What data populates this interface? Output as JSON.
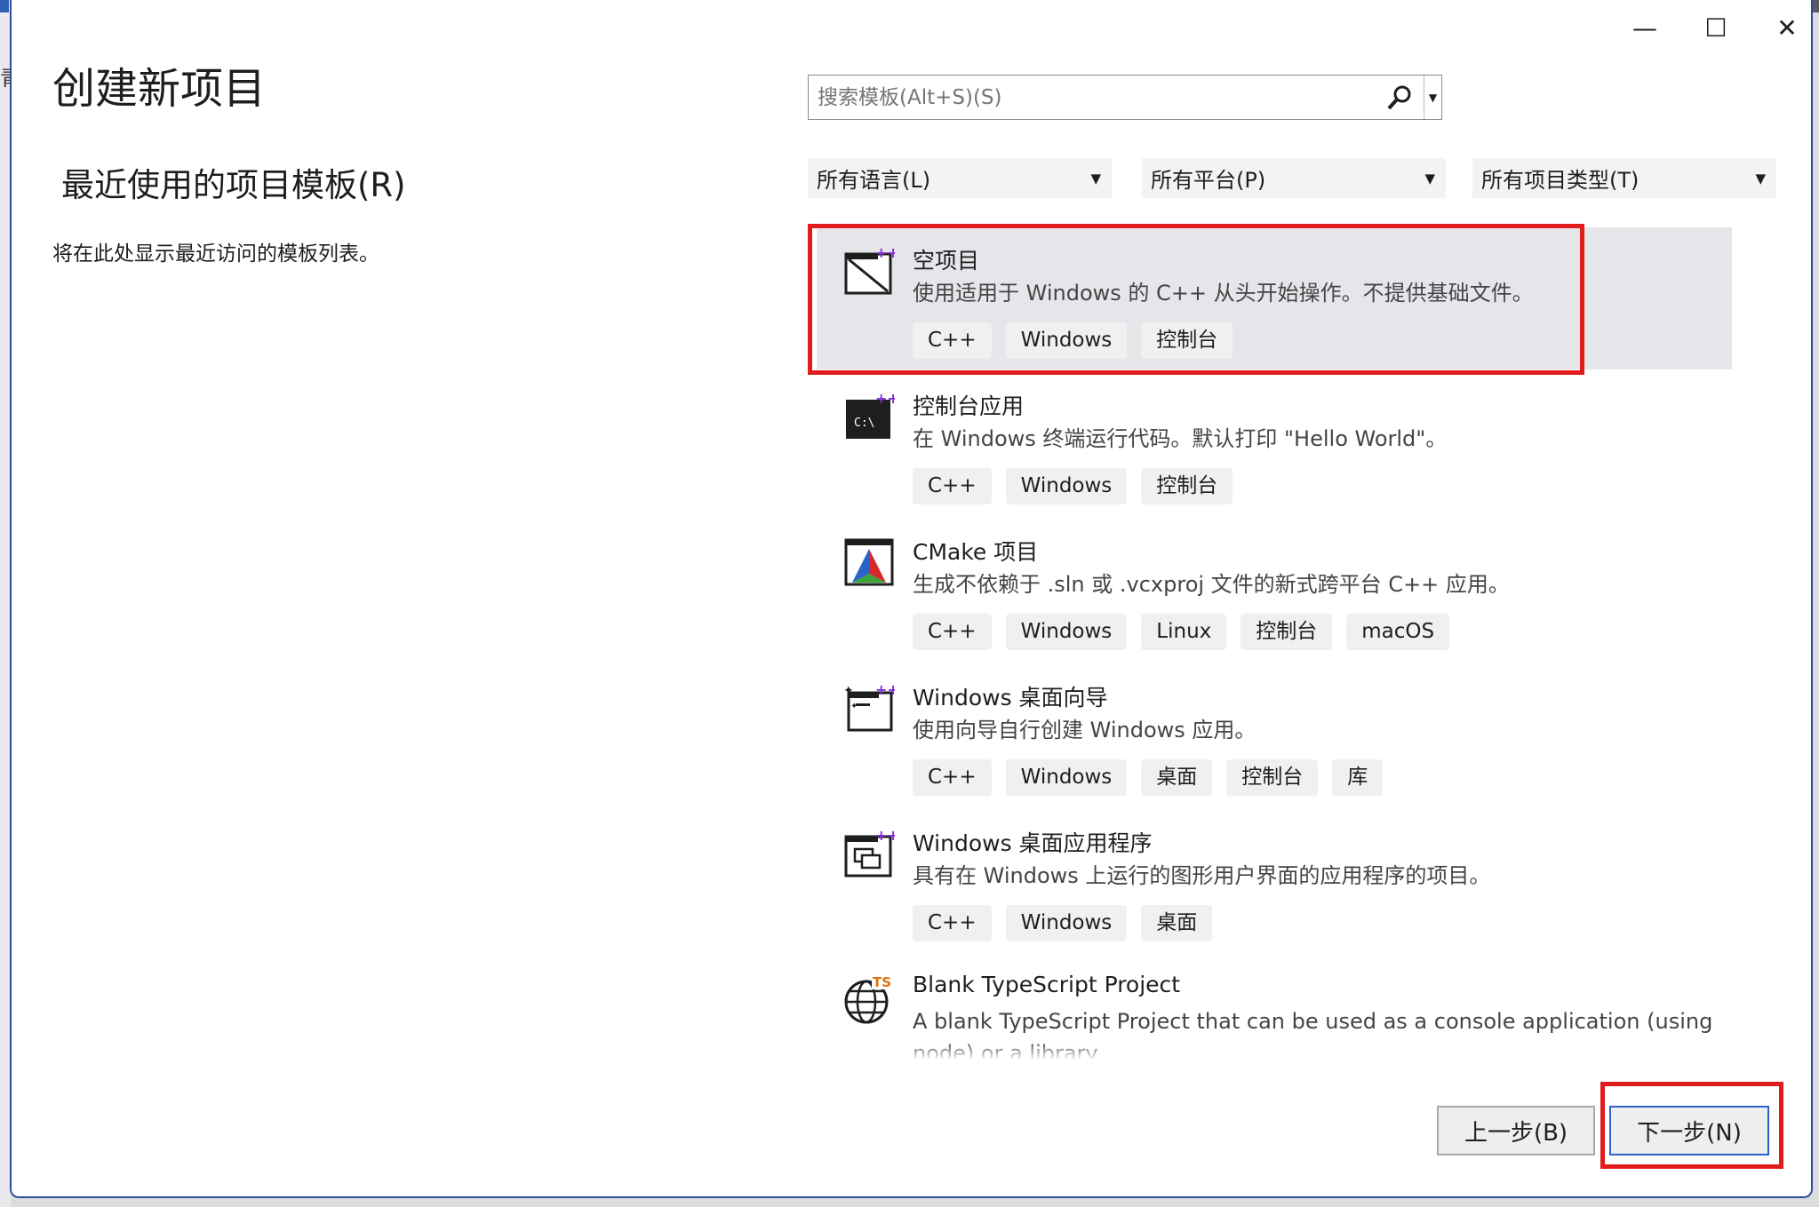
{
  "window": {
    "title": "创建新项目",
    "controls": {
      "minimize": "—",
      "maximize": "☐",
      "close": "✕"
    }
  },
  "background": {
    "left_glyph": "青"
  },
  "recent": {
    "heading": "最近使用的项目模板(R)",
    "empty_text": "将在此处显示最近访问的模板列表。"
  },
  "search": {
    "placeholder": "搜索模板(Alt+S)(S)"
  },
  "filters": [
    {
      "label": "所有语言(L)"
    },
    {
      "label": "所有平台(P)"
    },
    {
      "label": "所有项目类型(T)"
    }
  ],
  "templates": [
    {
      "name": "空项目",
      "description": "使用适用于 Windows 的 C++ 从头开始操作。不提供基础文件。",
      "tags": [
        "C++",
        "Windows",
        "控制台"
      ],
      "icon": "empty-project-icon",
      "selected": true
    },
    {
      "name": "控制台应用",
      "description": "在 Windows 终端运行代码。默认打印 \"Hello World\"。",
      "tags": [
        "C++",
        "Windows",
        "控制台"
      ],
      "icon": "console-app-icon",
      "icon_text": "C:\\"
    },
    {
      "name": "CMake 项目",
      "description": "生成不依赖于 .sln 或 .vcxproj 文件的新式跨平台 C++ 应用。",
      "tags": [
        "C++",
        "Windows",
        "Linux",
        "控制台",
        "macOS"
      ],
      "icon": "cmake-icon"
    },
    {
      "name": "Windows 桌面向导",
      "description": "使用向导自行创建 Windows 应用。",
      "tags": [
        "C++",
        "Windows",
        "桌面",
        "控制台",
        "库"
      ],
      "icon": "desktop-wizard-icon"
    },
    {
      "name": "Windows 桌面应用程序",
      "description": "具有在 Windows 上运行的图形用户界面的应用程序的项目。",
      "tags": [
        "C++",
        "Windows",
        "桌面"
      ],
      "icon": "desktop-app-icon"
    },
    {
      "name": "Blank TypeScript Project",
      "description": "A blank TypeScript Project that can be used as a console application (using node) or a library",
      "tags": [],
      "icon": "typescript-globe-icon",
      "icon_text": "TS"
    }
  ],
  "buttons": {
    "back": "上一步(B)",
    "next": "下一步(N)"
  },
  "colors": {
    "accent_purple": "#8a2be2",
    "highlight_red": "#e01c1c",
    "window_border": "#2d4f9b",
    "selected_bg": "#e4e6ea"
  }
}
